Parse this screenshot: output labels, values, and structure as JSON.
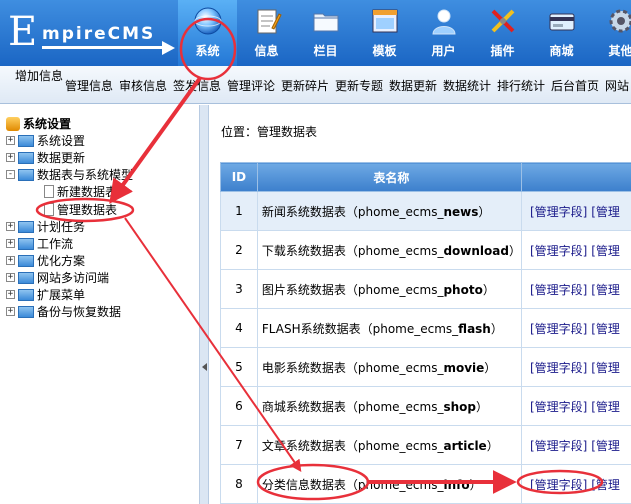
{
  "logo": {
    "first_letter": "E",
    "rest": "mpireCMS"
  },
  "topnav": [
    {
      "label": "系统",
      "icon": "globe-icon",
      "active": true
    },
    {
      "label": "信息",
      "icon": "notepad-icon"
    },
    {
      "label": "栏目",
      "icon": "folder-icon"
    },
    {
      "label": "模板",
      "icon": "window-icon"
    },
    {
      "label": "用户",
      "icon": "user-icon"
    },
    {
      "label": "插件",
      "icon": "tools-icon"
    },
    {
      "label": "商城",
      "icon": "card-icon"
    },
    {
      "label": "其他",
      "icon": "gear-icon"
    }
  ],
  "subnav": {
    "add_info": "增加信息",
    "items": [
      "管理信息",
      "审核信息",
      "签发信息",
      "管理评论",
      "更新碎片",
      "更新专题",
      "数据更新",
      "数据统计",
      "排行统计",
      "后台首页",
      "网站"
    ]
  },
  "tree": {
    "root": "系统设置",
    "items": [
      {
        "label": "系统设置",
        "sign": "+"
      },
      {
        "label": "数据更新",
        "sign": "+"
      },
      {
        "label": "数据表与系统模型",
        "sign": "-"
      },
      {
        "label": "新建数据表",
        "child": true
      },
      {
        "label": "管理数据表",
        "child": true
      },
      {
        "label": "计划任务",
        "sign": "+"
      },
      {
        "label": "工作流",
        "sign": "+"
      },
      {
        "label": "优化方案",
        "sign": "+"
      },
      {
        "label": "网站多访问端",
        "sign": "+"
      },
      {
        "label": "扩展菜单",
        "sign": "+"
      },
      {
        "label": "备份与恢复数据",
        "sign": "+"
      }
    ]
  },
  "breadcrumb": {
    "prefix": "位置：",
    "current": "管理数据表"
  },
  "table": {
    "headers": {
      "id": "ID",
      "name": "表名称"
    },
    "action1": "[管理字段]",
    "action2": "[管理",
    "rows": [
      {
        "id": "1",
        "name": "新闻系统数据表",
        "open": "（",
        "prefix": "phome_ecms_",
        "suffix": "news",
        "close": "）"
      },
      {
        "id": "2",
        "name": "下载系统数据表",
        "open": "（",
        "prefix": "phome_ecms_",
        "suffix": "download",
        "close": "）"
      },
      {
        "id": "3",
        "name": "图片系统数据表",
        "open": "（",
        "prefix": "phome_ecms_",
        "suffix": "photo",
        "close": "）"
      },
      {
        "id": "4",
        "name": "FLASH系统数据表",
        "open": "（",
        "prefix": "phome_ecms_",
        "suffix": "flash",
        "close": "）"
      },
      {
        "id": "5",
        "name": "电影系统数据表",
        "open": "（",
        "prefix": "phome_ecms_",
        "suffix": "movie",
        "close": "）"
      },
      {
        "id": "6",
        "name": "商城系统数据表",
        "open": "（",
        "prefix": "phome_ecms_",
        "suffix": "shop",
        "close": "）"
      },
      {
        "id": "7",
        "name": "文章系统数据表",
        "open": "（",
        "prefix": "phome_ecms_",
        "suffix": "article",
        "close": "）"
      },
      {
        "id": "8",
        "name": "分类信息数据表",
        "open": "（",
        "prefix": "phome_ecms_",
        "suffix": "info",
        "close": "）"
      }
    ]
  },
  "colors": {
    "header": "#1b66c4",
    "annotation": "#e8303a",
    "row_highlight": "#e4eef9"
  }
}
